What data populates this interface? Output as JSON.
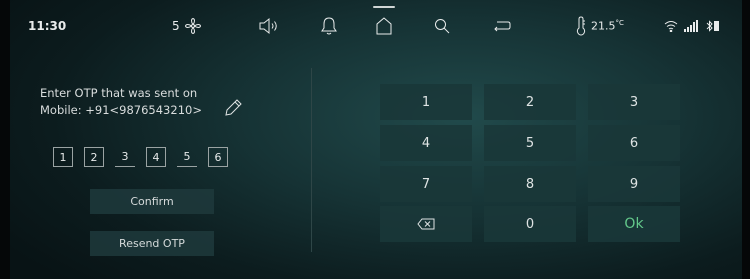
{
  "status_bar": {
    "time": "11:30",
    "fan_speed": "5",
    "temperature": "21.5",
    "temperature_unit": "°C",
    "icons": [
      "fan-icon",
      "speaker-icon",
      "bell-icon",
      "home-icon",
      "search-icon",
      "back-icon",
      "thermometer-icon",
      "wifi-icon",
      "signal-icon",
      "bluetooth-icon"
    ]
  },
  "otp": {
    "prompt_line1": "Enter OTP that was sent on",
    "prompt_line2": "Mobile: +91<9876543210>",
    "digits": [
      "1",
      "2",
      "3",
      "4",
      "5",
      "6"
    ],
    "confirm_label": "Confirm",
    "resend_label": "Resend OTP"
  },
  "keypad": {
    "keys": [
      "1",
      "2",
      "3",
      "4",
      "5",
      "6",
      "7",
      "8",
      "9",
      "backspace",
      "0",
      "Ok"
    ],
    "ok_color": "#63c98b"
  },
  "colors": {
    "background": "#163335",
    "key_background": "#1a3739"
  }
}
